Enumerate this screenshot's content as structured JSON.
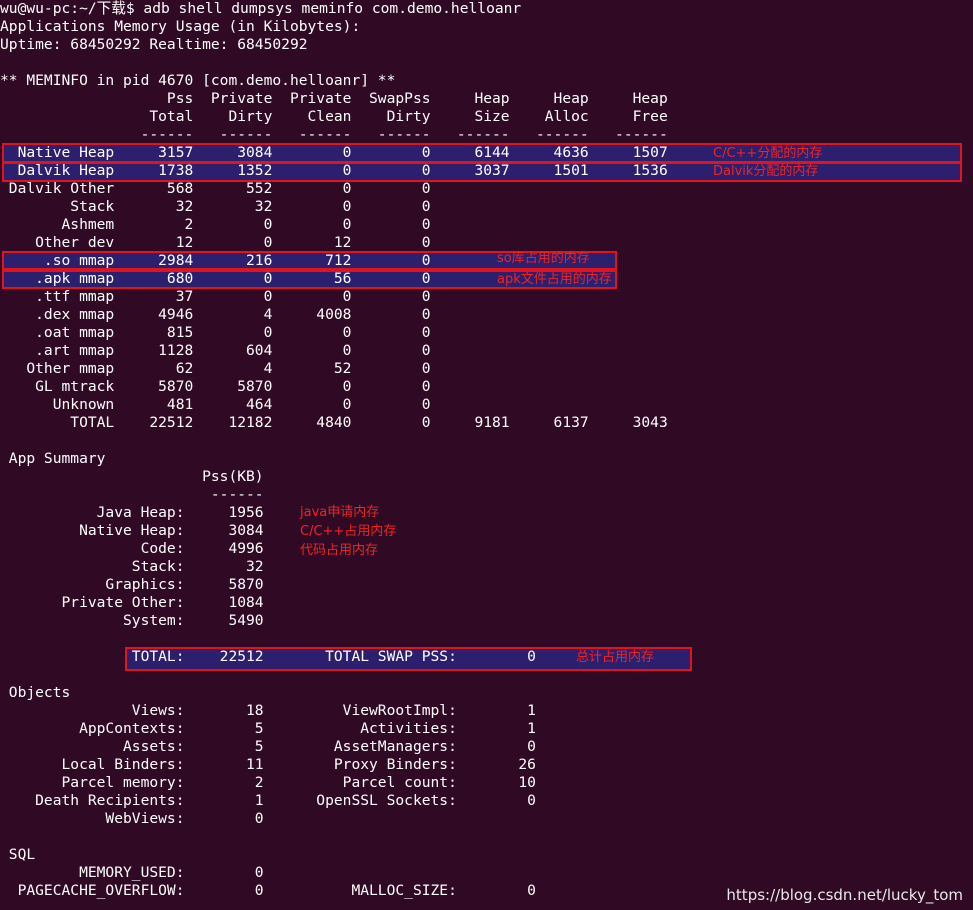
{
  "terminal": {
    "lines": [
      "wu@wu-pc:~/下载$ adb shell dumpsys meminfo com.demo.helloanr",
      "Applications Memory Usage (in Kilobytes):",
      "Uptime: 68450292 Realtime: 68450292",
      "",
      "** MEMINFO in pid 4670 [com.demo.helloanr] **",
      "                   Pss  Private  Private  SwapPss     Heap     Heap     Heap",
      "                 Total    Dirty    Clean    Dirty     Size    Alloc     Free",
      "                ------   ------   ------   ------   ------   ------   ------",
      "  Native Heap     3157     3084        0        0     6144     4636     1507",
      "  Dalvik Heap     1738     1352        0        0     3037     1501     1536",
      " Dalvik Other      568      552        0        0",
      "        Stack       32       32        0        0",
      "       Ashmem        2        0        0        0",
      "    Other dev       12        0       12        0",
      "     .so mmap     2984      216      712        0",
      "    .apk mmap      680        0       56        0",
      "    .ttf mmap       37        0        0        0",
      "    .dex mmap     4946        4     4008        0",
      "    .oat mmap      815        0        0        0",
      "    .art mmap     1128      604        0        0",
      "   Other mmap       62        4       52        0",
      "    GL mtrack     5870     5870        0        0",
      "      Unknown      481      464        0        0",
      "        TOTAL    22512    12182     4840        0     9181     6137     3043",
      "",
      " App Summary",
      "                       Pss(KB)",
      "                        ------",
      "           Java Heap:     1956",
      "         Native Heap:     3084",
      "                Code:     4996",
      "               Stack:       32",
      "            Graphics:     5870",
      "       Private Other:     1084",
      "              System:     5490",
      "",
      "               TOTAL:    22512       TOTAL SWAP PSS:        0",
      "",
      " Objects",
      "               Views:       18         ViewRootImpl:        1",
      "         AppContexts:        5           Activities:        1",
      "              Assets:        5        AssetManagers:        0",
      "       Local Binders:       11        Proxy Binders:       26",
      "       Parcel memory:        2         Parcel count:       10",
      "    Death Recipients:        1      OpenSSL Sockets:        0",
      "            WebViews:        0",
      "",
      " SQL",
      "         MEMORY_USED:        0",
      "  PAGECACHE_OVERFLOW:        0          MALLOC_SIZE:        0"
    ]
  },
  "annotations": {
    "native_heap": "C/C++分配的内存",
    "dalvik_heap": "Dalvik分配的内存",
    "so_mmap": "so库占用的内存",
    "apk_mmap": "apk文件占用的内存",
    "java_heap": "java申请内存",
    "native_summary": "C/C++占用内存",
    "code": "代码占用内存",
    "total": "总计占用内存"
  },
  "watermark": "https://blog.csdn.net/lucky_tom",
  "colors": {
    "background": "#300a24",
    "highlight": "#2c1f6e",
    "box_border": "#e3121b",
    "annotation_text": "#ee2424"
  }
}
